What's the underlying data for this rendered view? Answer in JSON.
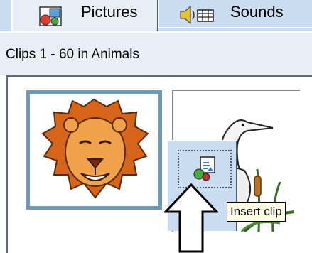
{
  "tabs": [
    {
      "label": "Pictures",
      "icon": "pictures-icon",
      "active": true
    },
    {
      "label": "Sounds",
      "icon": "sounds-icon",
      "active": false
    }
  ],
  "header": {
    "text": "Clips 1 - 60 in Animals"
  },
  "clips": [
    {
      "name": "lion-clip",
      "selected": true
    },
    {
      "name": "heron-clip",
      "selected": false
    }
  ],
  "popup": {
    "button_icon": "insert-clip-icon",
    "tooltip": "Insert clip"
  },
  "annotation": {
    "icon": "up-arrow-icon"
  },
  "colors": {
    "tab_bg": "#c9dcf0",
    "panel_bg": "#e8eef6",
    "selection_border": "#6f9bb8",
    "tooltip_bg": "#ffffe6"
  }
}
